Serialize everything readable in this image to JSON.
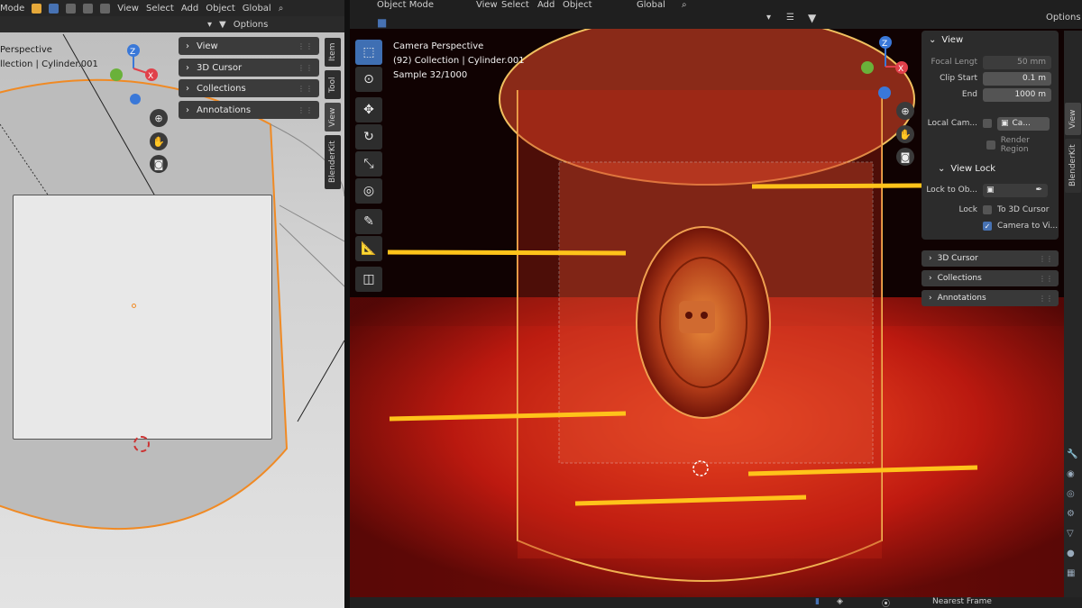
{
  "left_viewport": {
    "header": {
      "mode": "Mode",
      "menus": [
        "View",
        "Select",
        "Add",
        "Object"
      ],
      "transform": "Global",
      "options": "Options"
    },
    "overlay": {
      "view_name": "Perspective",
      "collection": "llection | Cylinder.001"
    },
    "panel": {
      "rows": [
        "View",
        "3D Cursor",
        "Collections",
        "Annotations"
      ]
    },
    "tabs": [
      "Item",
      "Tool",
      "View",
      "BlenderKit"
    ]
  },
  "right_viewport": {
    "header": {
      "mode": "Object Mode",
      "menus": [
        "View",
        "Select",
        "Add",
        "Object"
      ],
      "transform": "Global",
      "options": "Options"
    },
    "overlay": {
      "view_name": "Camera Perspective",
      "collection": "(92) Collection | Cylinder.001",
      "sample": "Sample 32/1000"
    },
    "view_panel": {
      "title": "View",
      "focal_length": {
        "label": "Focal Lengt",
        "value": "50 mm"
      },
      "clip_start": {
        "label": "Clip Start",
        "value": "0.1 m"
      },
      "clip_end": {
        "label": "End",
        "value": "1000 m"
      },
      "local_camera": {
        "label": "Local Cam...",
        "value": "Ca..."
      },
      "render_region": "Render Region",
      "view_lock": {
        "title": "View Lock",
        "lock_to_object": "Lock to Ob...",
        "lock_label": "Lock",
        "to_3d_cursor": "To 3D Cursor",
        "camera_to_view": "Camera to Vi..."
      }
    },
    "sections": [
      "3D Cursor",
      "Collections",
      "Annotations"
    ],
    "side_tabs": [
      "View",
      "BlenderKit"
    ],
    "status": {
      "snap": "Nearest Frame"
    }
  },
  "colors": {
    "accent_blue": "#4772b3",
    "selection_orange": "#f08a24",
    "axis_x": "#e0404a",
    "axis_y": "#6ab13a",
    "axis_z": "#3a78d8"
  }
}
